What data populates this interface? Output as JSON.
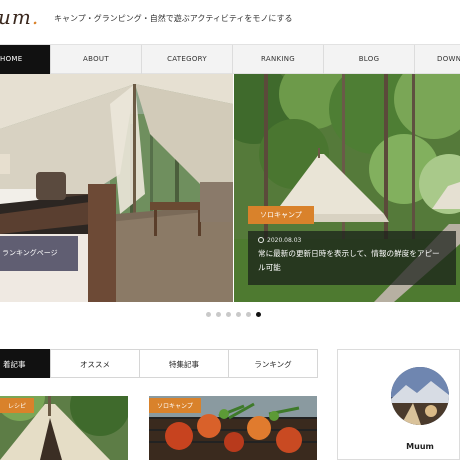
{
  "header": {
    "logo_text": "um",
    "tagline": "キャンプ・グランピング・自然で遊ぶアクティビティをモノにする"
  },
  "nav": {
    "items": [
      {
        "label": "HOME",
        "active": true
      },
      {
        "label": "ABOUT",
        "active": false
      },
      {
        "label": "CATEGORY",
        "active": false
      },
      {
        "label": "RANKING",
        "active": false
      },
      {
        "label": "BLOG",
        "active": false
      },
      {
        "label": "DOWN",
        "active": false
      }
    ]
  },
  "slider": {
    "slide1": {
      "label": "ランキングページ"
    },
    "slide2": {
      "category": "ソロキャンプ",
      "date": "2020.08.03",
      "title": "常に最新の更新日時を表示して、情報の鮮度をアピール可能"
    },
    "dots": {
      "count": 6,
      "active_index": 5
    }
  },
  "tabs": [
    {
      "label": "着記事",
      "active": true
    },
    {
      "label": "オススメ",
      "active": false
    },
    {
      "label": "特集記事",
      "active": false
    },
    {
      "label": "ランキング",
      "active": false
    }
  ],
  "cards": [
    {
      "badge": "レシピ"
    },
    {
      "badge": "ソロキャンプ"
    }
  ],
  "profile": {
    "name": "Muum"
  },
  "colors": {
    "accent": "#d9822b",
    "nav_active": "#111111"
  }
}
